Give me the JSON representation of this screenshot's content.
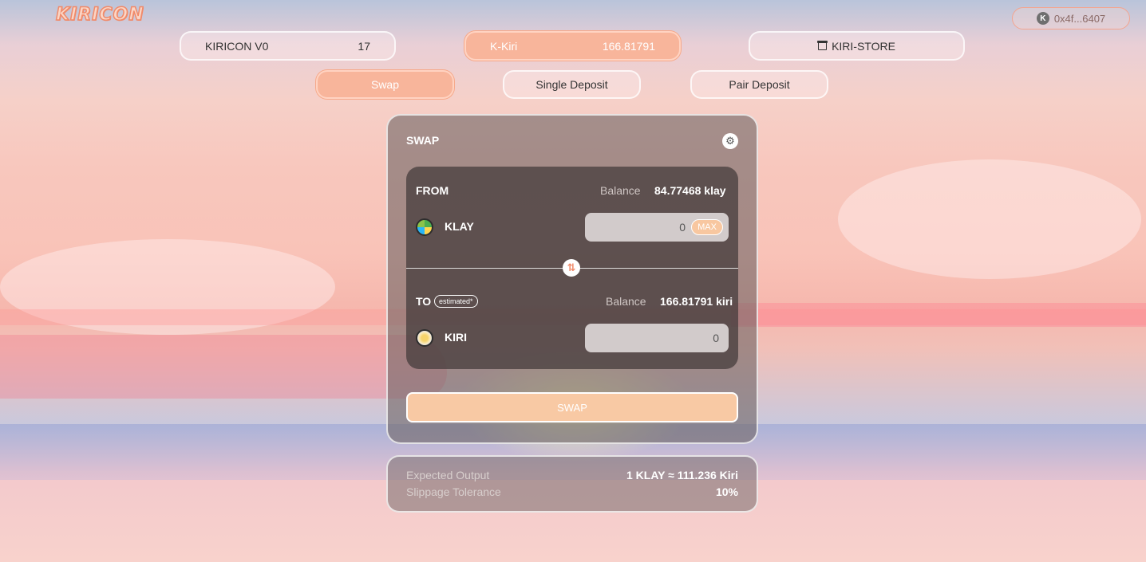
{
  "brand": {
    "logo_text": "KIRICON"
  },
  "wallet": {
    "address": "0x4f...6407",
    "icon": "klaytn-icon"
  },
  "top_nav": {
    "v0": {
      "label": "KIRICON V0",
      "value": "17"
    },
    "kkiri": {
      "label": "K-Kiri",
      "value": "166.81791"
    },
    "store": {
      "label": "KIRI-STORE",
      "icon": "store-icon"
    }
  },
  "tabs": [
    {
      "label": "Swap",
      "active": true
    },
    {
      "label": "Single Deposit",
      "active": false
    },
    {
      "label": "Pair Deposit",
      "active": false
    }
  ],
  "swap_card": {
    "title": "SWAP",
    "settings_icon": "gear-icon",
    "from": {
      "label": "FROM",
      "balance_label": "Balance",
      "balance_value": "84.77468 klay",
      "token": "KLAY",
      "amount": "0",
      "max_label": "MAX"
    },
    "switch_icon": "swap-arrows-icon",
    "to": {
      "label": "TO",
      "badge": "estimated*",
      "balance_label": "Balance",
      "balance_value": "166.81791 kiri",
      "token": "KIRI",
      "amount": "0"
    },
    "swap_button": "SWAP"
  },
  "info": {
    "expected_output_label": "Expected Output",
    "expected_output_value": "1 KLAY ≈ 111.236 Kiri",
    "slippage_label": "Slippage Tolerance",
    "slippage_value": "10%"
  },
  "colors": {
    "accent": "#f8b59b",
    "button": "#f8c9a4",
    "panel": "#463c3c"
  }
}
